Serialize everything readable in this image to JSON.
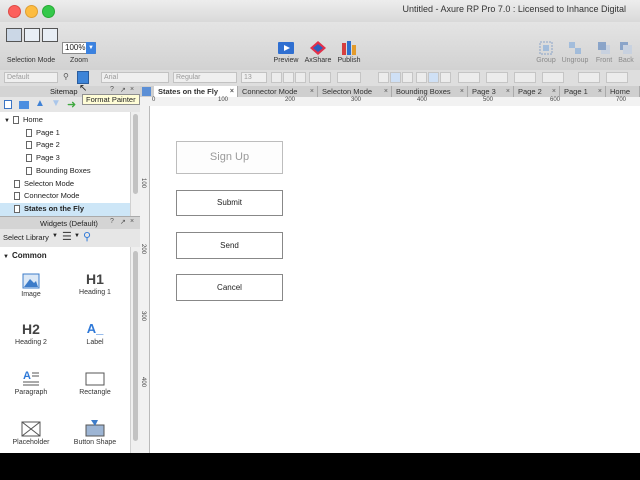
{
  "window": {
    "title": "Untitled - Axure RP Pro 7.0 : Licensed to Inhance Digital"
  },
  "toolbar": {
    "selection_mode": "Selection Mode",
    "zoom_label": "Zoom",
    "zoom_value": "100%",
    "preview": "Preview",
    "axshare": "AxShare",
    "publish": "Publish",
    "group": "Group",
    "ungroup": "Ungroup",
    "front": "Front",
    "back": "Back"
  },
  "format_bar": {
    "style": "Default",
    "font": "Arial",
    "weight": "Regular",
    "size": "13"
  },
  "tooltip": "Format Painter",
  "sitemap": {
    "header": "Sitemap",
    "items": [
      {
        "label": "Home",
        "level": 0
      },
      {
        "label": "Page 1",
        "level": 1
      },
      {
        "label": "Page 2",
        "level": 1
      },
      {
        "label": "Page 3",
        "level": 1
      },
      {
        "label": "Bounding Boxes",
        "level": 1
      },
      {
        "label": "Selecton Mode",
        "level": 0
      },
      {
        "label": "Connector Mode",
        "level": 0
      },
      {
        "label": "States on the Fly",
        "level": 0,
        "selected": true
      }
    ]
  },
  "widgets": {
    "header": "Widgets (Default)",
    "library": "Select Library",
    "section": "Common",
    "items": [
      {
        "label": "Image",
        "icon": "image-icon"
      },
      {
        "label": "Heading 1",
        "icon": "heading1-icon",
        "glyph": "H1"
      },
      {
        "label": "Heading 2",
        "icon": "heading2-icon",
        "glyph": "H2"
      },
      {
        "label": "Label",
        "icon": "label-icon",
        "glyph": "A_"
      },
      {
        "label": "Paragraph",
        "icon": "paragraph-icon"
      },
      {
        "label": "Rectangle",
        "icon": "rectangle-icon"
      },
      {
        "label": "Placeholder",
        "icon": "placeholder-icon"
      },
      {
        "label": "Button Shape",
        "icon": "button-shape-icon"
      }
    ]
  },
  "tabs": [
    {
      "label": "States on the Fly",
      "active": true
    },
    {
      "label": "Connector Mode"
    },
    {
      "label": "Selecton Mode"
    },
    {
      "label": "Bounding Boxes"
    },
    {
      "label": "Page 3"
    },
    {
      "label": "Page 2"
    },
    {
      "label": "Page 1"
    },
    {
      "label": "Home"
    }
  ],
  "rulers": {
    "top": [
      "0",
      "100",
      "200",
      "300",
      "400",
      "500",
      "600",
      "700"
    ],
    "left": [
      "100",
      "200",
      "300",
      "400"
    ]
  },
  "canvas": {
    "signup": "Sign Up",
    "submit": "Submit",
    "send": "Send",
    "cancel": "Cancel"
  }
}
